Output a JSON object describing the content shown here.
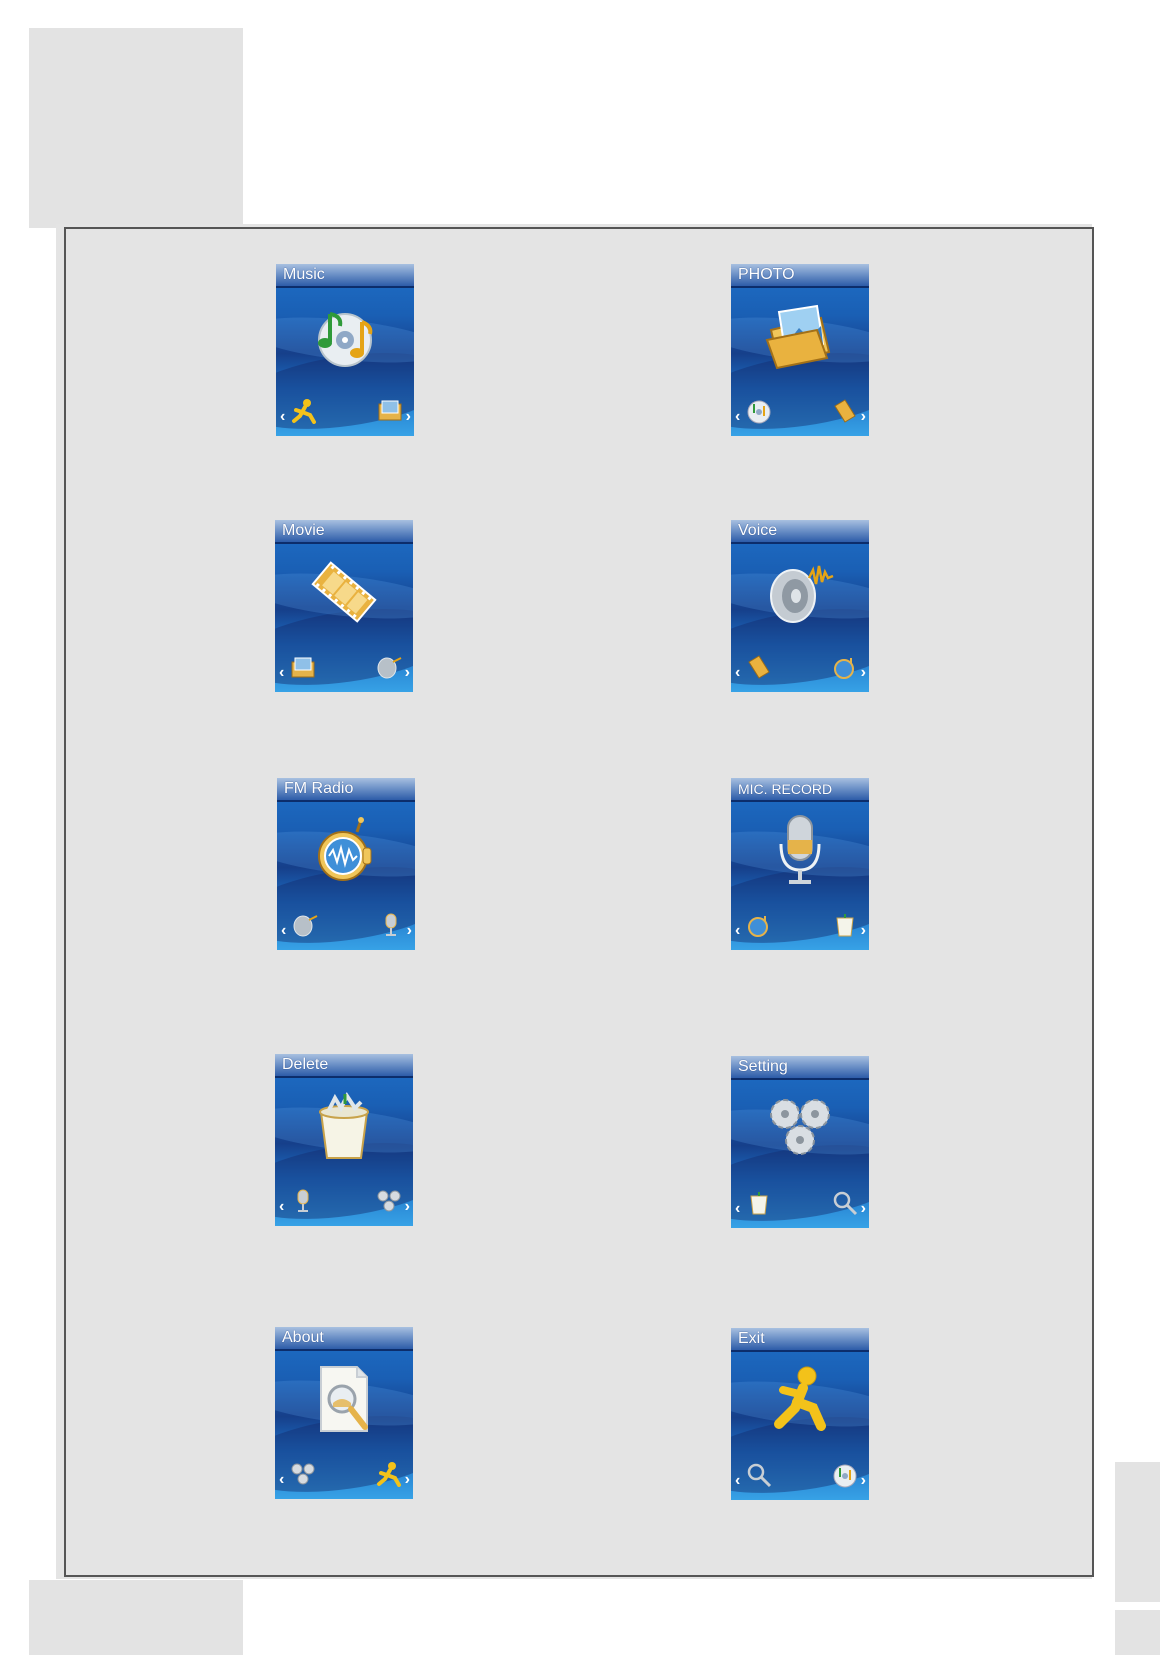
{
  "screens": [
    {
      "title": "Music",
      "left_icon": "exit-runner-icon",
      "main_icon": "music-disc-icon",
      "right_icon": "photo-folder-icon"
    },
    {
      "title": "PHOTO",
      "left_icon": "music-disc-icon",
      "main_icon": "photo-folder-icon",
      "right_icon": "movie-film-icon"
    },
    {
      "title": "Movie",
      "left_icon": "photo-folder-icon",
      "main_icon": "movie-film-icon",
      "right_icon": "voice-speaker-icon"
    },
    {
      "title": "Voice",
      "left_icon": "movie-film-icon",
      "main_icon": "voice-speaker-icon",
      "right_icon": "fm-radio-icon"
    },
    {
      "title": "FM Radio",
      "left_icon": "voice-speaker-icon",
      "main_icon": "fm-radio-icon",
      "right_icon": "microphone-icon"
    },
    {
      "title": "MIC. RECORD",
      "left_icon": "fm-radio-icon",
      "main_icon": "microphone-icon",
      "right_icon": "trash-bin-icon"
    },
    {
      "title": "Delete",
      "left_icon": "microphone-icon",
      "main_icon": "trash-bin-icon",
      "right_icon": "gears-icon"
    },
    {
      "title": "Setting",
      "left_icon": "trash-bin-icon",
      "main_icon": "gears-icon",
      "right_icon": "magnifier-icon"
    },
    {
      "title": "About",
      "left_icon": "gears-icon",
      "main_icon": "about-document-icon",
      "right_icon": "exit-runner-icon"
    },
    {
      "title": "Exit",
      "left_icon": "magnifier-icon",
      "main_icon": "exit-runner-icon",
      "right_icon": "music-disc-icon"
    }
  ],
  "nav": {
    "left": "‹",
    "right": "›"
  }
}
